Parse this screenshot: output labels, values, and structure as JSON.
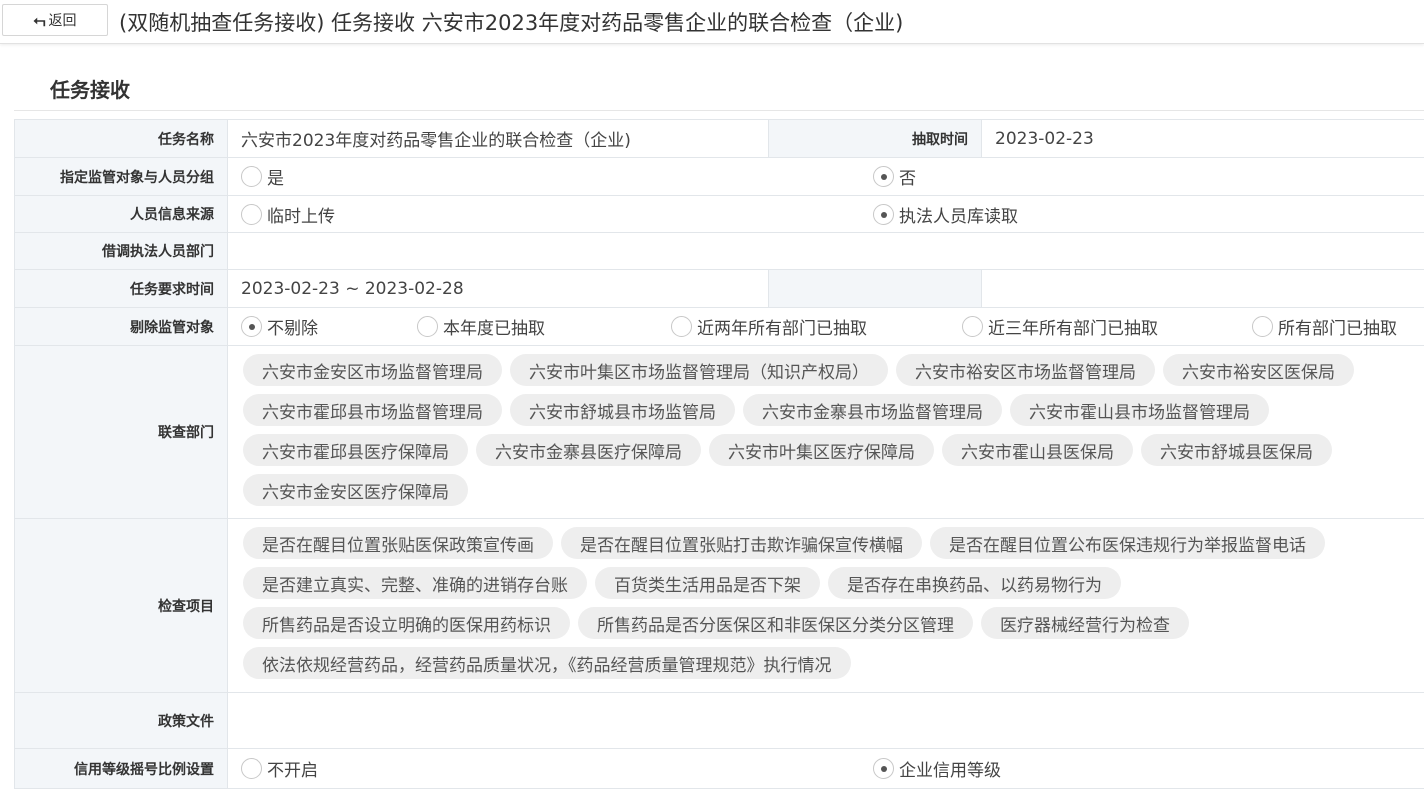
{
  "header": {
    "back_label": "返回",
    "title": "(双随机抽查任务接收) 任务接收 六安市2023年度对药品零售企业的联合检查（企业)"
  },
  "section": {
    "title": "任务接收"
  },
  "form": {
    "task_name": {
      "label": "任务名称",
      "value": "六安市2023年度对药品零售企业的联合检查（企业)"
    },
    "draw_time": {
      "label": "抽取时间",
      "value": "2023-02-23"
    },
    "assign_group": {
      "label": "指定监管对象与人员分组",
      "options": [
        "是",
        "否"
      ],
      "selected": "否"
    },
    "staff_source": {
      "label": "人员信息来源",
      "options": [
        "临时上传",
        "执法人员库读取"
      ],
      "selected": "执法人员库读取"
    },
    "borrow_dept": {
      "label": "借调执法人员部门",
      "value": ""
    },
    "required_time": {
      "label": "任务要求时间",
      "value": "2023-02-23 ~ 2023-02-28"
    },
    "exclude": {
      "label": "剔除监管对象",
      "options": [
        "不剔除",
        "本年度已抽取",
        "近两年所有部门已抽取",
        "近三年所有部门已抽取",
        "所有部门已抽取"
      ],
      "selected": "不剔除"
    },
    "joint_depts": {
      "label": "联查部门",
      "items": [
        "六安市金安区市场监督管理局",
        "六安市叶集区市场监督管理局（知识产权局）",
        "六安市裕安区市场监督管理局",
        "六安市裕安区医保局",
        "六安市霍邱县市场监督管理局",
        "六安市舒城县市场监管局",
        "六安市金寨县市场监督管理局",
        "六安市霍山县市场监督管理局",
        "六安市霍邱县医疗保障局",
        "六安市金寨县医疗保障局",
        "六安市叶集区医疗保障局",
        "六安市霍山县医保局",
        "六安市舒城县医保局",
        "六安市金安区医疗保障局"
      ]
    },
    "check_items": {
      "label": "检查项目",
      "items": [
        "是否在醒目位置张贴医保政策宣传画",
        "是否在醒目位置张贴打击欺诈骗保宣传横幅",
        "是否在醒目位置公布医保违规行为举报监督电话",
        "是否建立真实、完整、准确的进销存台账",
        "百货类生活用品是否下架",
        "是否存在串换药品、以药易物行为",
        "所售药品是否设立明确的医保用药标识",
        "所售药品是否分医保区和非医保区分类分区管理",
        "医疗器械经营行为检查",
        "依法依规经营药品，经营药品质量状况，《药品经营质量管理规范》执行情况"
      ]
    },
    "policy_docs": {
      "label": "政策文件",
      "value": ""
    },
    "credit_ratio": {
      "label": "信用等级摇号比例设置",
      "options": [
        "不开启",
        "企业信用等级"
      ],
      "selected": "企业信用等级"
    }
  }
}
